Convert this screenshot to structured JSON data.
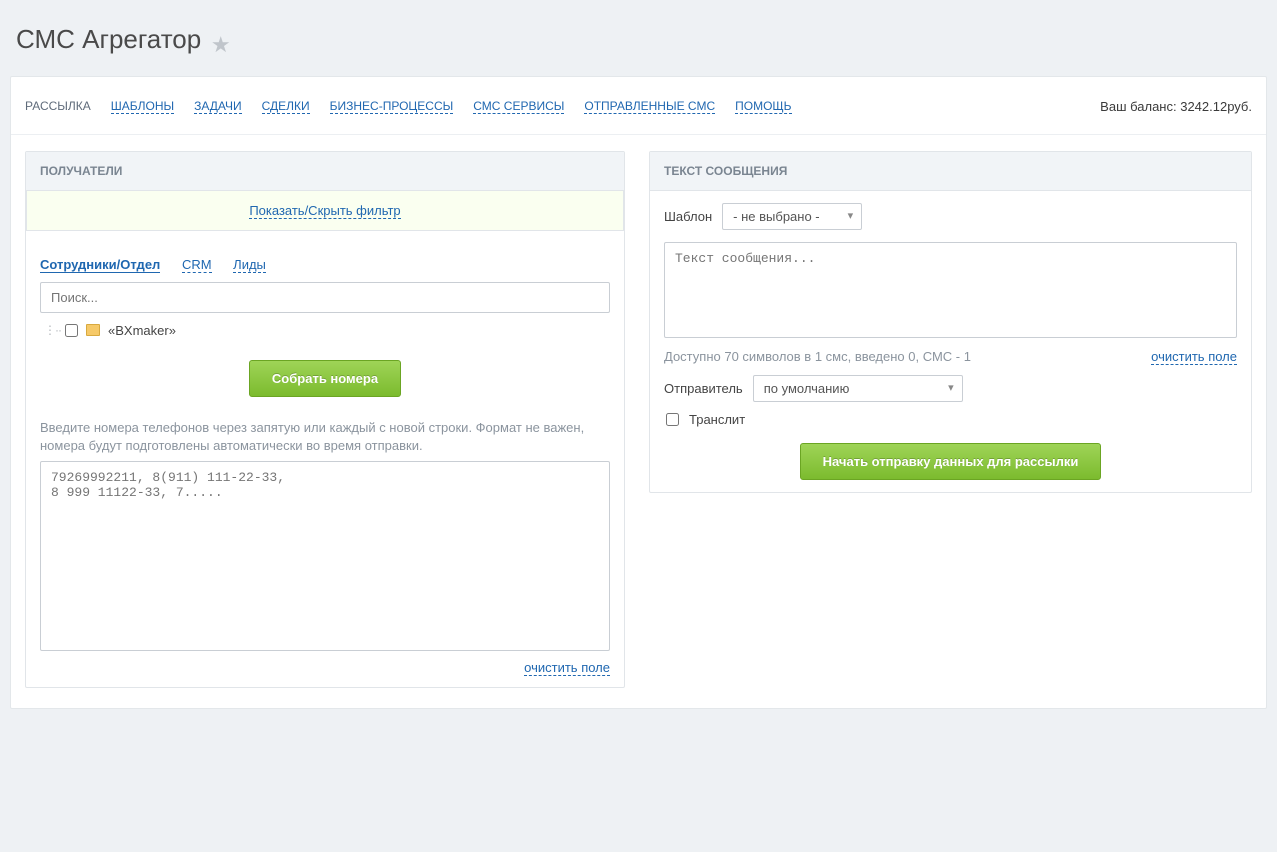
{
  "header": {
    "title": "СМС Агрегатор"
  },
  "nav": {
    "items": [
      {
        "label": "РАССЫЛКА",
        "active": true
      },
      {
        "label": "ШАБЛОНЫ"
      },
      {
        "label": "ЗАДАЧИ"
      },
      {
        "label": "СДЕЛКИ"
      },
      {
        "label": "БИЗНЕС-ПРОЦЕССЫ"
      },
      {
        "label": "СМС СЕРВИСЫ"
      },
      {
        "label": "ОТПРАВЛЕННЫЕ СМС"
      },
      {
        "label": "ПОМОЩЬ"
      }
    ],
    "balance_label": "Ваш баланс: 3242.12руб."
  },
  "recipients": {
    "block_title": "ПОЛУЧАТЕЛИ",
    "filter_toggle": "Показать/Скрыть фильтр",
    "tabs": [
      {
        "label": "Сотрудники/Отдел",
        "active": true
      },
      {
        "label": "CRM"
      },
      {
        "label": "Лиды"
      }
    ],
    "search_placeholder": "Поиск...",
    "tree_item": "«BXmaker»",
    "collect_button": "Собрать номера",
    "help_text": "Введите номера телефонов через запятую или каждый с новой строки. Формат не важен, номера будут подготовлены автоматически во время отправки.",
    "phones_placeholder": "79269992211, 8(911) 111-22-33,\n8 999 11122-33, 7.....",
    "clear_label": "очистить поле"
  },
  "message": {
    "block_title": "ТЕКСТ СООБЩЕНИЯ",
    "template_label": "Шаблон",
    "template_value": "- не выбрано -",
    "text_placeholder": "Текст сообщения...",
    "status_text": "Доступно 70 символов в 1 смс, введено 0, СМС - 1",
    "clear_label": "очистить поле",
    "sender_label": "Отправитель",
    "sender_value": "по умолчанию",
    "translit_label": "Транслит",
    "submit_button": "Начать отправку данных для рассылки"
  }
}
